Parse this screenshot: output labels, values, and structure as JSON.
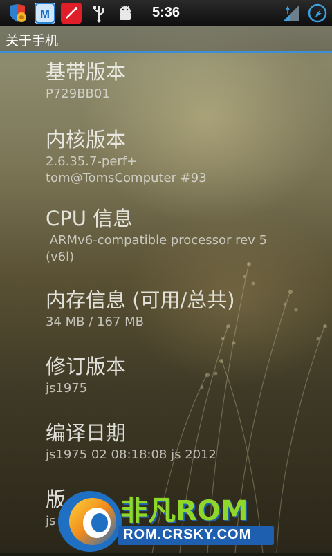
{
  "status_bar": {
    "time": "5:36",
    "icons": [
      "shield-notification-icon",
      "maxthon-browser-icon",
      "red-app-icon",
      "usb-icon",
      "android-debug-icon",
      "signal-icon",
      "sync-icon"
    ]
  },
  "title_bar": {
    "title": "关于手机"
  },
  "items": [
    {
      "label": "基带版本",
      "value": "P729BB01"
    },
    {
      "label": "内核版本",
      "value": "2.6.35.7-perf+\ntom@TomsComputer #93"
    },
    {
      "label": "CPU 信息",
      "value": " ARMv6-compatible processor rev 5 (v6l)"
    },
    {
      "label": "内存信息 (可用/总共)",
      "value": "34 MB / 167 MB"
    },
    {
      "label": "修订版本",
      "value": "js1975"
    },
    {
      "label": "编译日期",
      "value": "js1975 02 08:18:08 js 2012"
    },
    {
      "label": "版",
      "value": "js"
    }
  ],
  "watermark": {
    "brand": "非凡ROM",
    "url": "ROM.CRSKY.COM"
  },
  "colors": {
    "accent": "#3a8fd8",
    "watermark_green": "#8fd82a",
    "watermark_blue": "#1f6fc2"
  }
}
